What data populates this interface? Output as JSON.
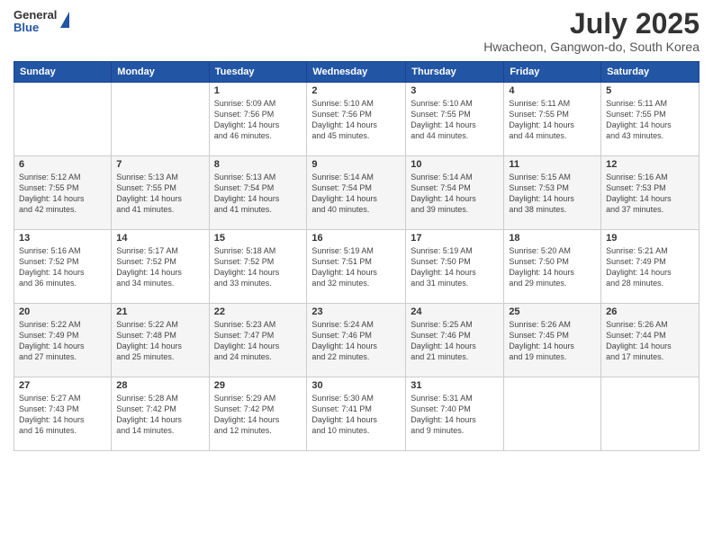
{
  "logo": {
    "line1": "General",
    "line2": "Blue"
  },
  "title": {
    "month_year": "July 2025",
    "location": "Hwacheon, Gangwon-do, South Korea"
  },
  "weekdays": [
    "Sunday",
    "Monday",
    "Tuesday",
    "Wednesday",
    "Thursday",
    "Friday",
    "Saturday"
  ],
  "weeks": [
    [
      {
        "day": "",
        "info": ""
      },
      {
        "day": "",
        "info": ""
      },
      {
        "day": "1",
        "info": "Sunrise: 5:09 AM\nSunset: 7:56 PM\nDaylight: 14 hours\nand 46 minutes."
      },
      {
        "day": "2",
        "info": "Sunrise: 5:10 AM\nSunset: 7:56 PM\nDaylight: 14 hours\nand 45 minutes."
      },
      {
        "day": "3",
        "info": "Sunrise: 5:10 AM\nSunset: 7:55 PM\nDaylight: 14 hours\nand 44 minutes."
      },
      {
        "day": "4",
        "info": "Sunrise: 5:11 AM\nSunset: 7:55 PM\nDaylight: 14 hours\nand 44 minutes."
      },
      {
        "day": "5",
        "info": "Sunrise: 5:11 AM\nSunset: 7:55 PM\nDaylight: 14 hours\nand 43 minutes."
      }
    ],
    [
      {
        "day": "6",
        "info": "Sunrise: 5:12 AM\nSunset: 7:55 PM\nDaylight: 14 hours\nand 42 minutes."
      },
      {
        "day": "7",
        "info": "Sunrise: 5:13 AM\nSunset: 7:55 PM\nDaylight: 14 hours\nand 41 minutes."
      },
      {
        "day": "8",
        "info": "Sunrise: 5:13 AM\nSunset: 7:54 PM\nDaylight: 14 hours\nand 41 minutes."
      },
      {
        "day": "9",
        "info": "Sunrise: 5:14 AM\nSunset: 7:54 PM\nDaylight: 14 hours\nand 40 minutes."
      },
      {
        "day": "10",
        "info": "Sunrise: 5:14 AM\nSunset: 7:54 PM\nDaylight: 14 hours\nand 39 minutes."
      },
      {
        "day": "11",
        "info": "Sunrise: 5:15 AM\nSunset: 7:53 PM\nDaylight: 14 hours\nand 38 minutes."
      },
      {
        "day": "12",
        "info": "Sunrise: 5:16 AM\nSunset: 7:53 PM\nDaylight: 14 hours\nand 37 minutes."
      }
    ],
    [
      {
        "day": "13",
        "info": "Sunrise: 5:16 AM\nSunset: 7:52 PM\nDaylight: 14 hours\nand 36 minutes."
      },
      {
        "day": "14",
        "info": "Sunrise: 5:17 AM\nSunset: 7:52 PM\nDaylight: 14 hours\nand 34 minutes."
      },
      {
        "day": "15",
        "info": "Sunrise: 5:18 AM\nSunset: 7:52 PM\nDaylight: 14 hours\nand 33 minutes."
      },
      {
        "day": "16",
        "info": "Sunrise: 5:19 AM\nSunset: 7:51 PM\nDaylight: 14 hours\nand 32 minutes."
      },
      {
        "day": "17",
        "info": "Sunrise: 5:19 AM\nSunset: 7:50 PM\nDaylight: 14 hours\nand 31 minutes."
      },
      {
        "day": "18",
        "info": "Sunrise: 5:20 AM\nSunset: 7:50 PM\nDaylight: 14 hours\nand 29 minutes."
      },
      {
        "day": "19",
        "info": "Sunrise: 5:21 AM\nSunset: 7:49 PM\nDaylight: 14 hours\nand 28 minutes."
      }
    ],
    [
      {
        "day": "20",
        "info": "Sunrise: 5:22 AM\nSunset: 7:49 PM\nDaylight: 14 hours\nand 27 minutes."
      },
      {
        "day": "21",
        "info": "Sunrise: 5:22 AM\nSunset: 7:48 PM\nDaylight: 14 hours\nand 25 minutes."
      },
      {
        "day": "22",
        "info": "Sunrise: 5:23 AM\nSunset: 7:47 PM\nDaylight: 14 hours\nand 24 minutes."
      },
      {
        "day": "23",
        "info": "Sunrise: 5:24 AM\nSunset: 7:46 PM\nDaylight: 14 hours\nand 22 minutes."
      },
      {
        "day": "24",
        "info": "Sunrise: 5:25 AM\nSunset: 7:46 PM\nDaylight: 14 hours\nand 21 minutes."
      },
      {
        "day": "25",
        "info": "Sunrise: 5:26 AM\nSunset: 7:45 PM\nDaylight: 14 hours\nand 19 minutes."
      },
      {
        "day": "26",
        "info": "Sunrise: 5:26 AM\nSunset: 7:44 PM\nDaylight: 14 hours\nand 17 minutes."
      }
    ],
    [
      {
        "day": "27",
        "info": "Sunrise: 5:27 AM\nSunset: 7:43 PM\nDaylight: 14 hours\nand 16 minutes."
      },
      {
        "day": "28",
        "info": "Sunrise: 5:28 AM\nSunset: 7:42 PM\nDaylight: 14 hours\nand 14 minutes."
      },
      {
        "day": "29",
        "info": "Sunrise: 5:29 AM\nSunset: 7:42 PM\nDaylight: 14 hours\nand 12 minutes."
      },
      {
        "day": "30",
        "info": "Sunrise: 5:30 AM\nSunset: 7:41 PM\nDaylight: 14 hours\nand 10 minutes."
      },
      {
        "day": "31",
        "info": "Sunrise: 5:31 AM\nSunset: 7:40 PM\nDaylight: 14 hours\nand 9 minutes."
      },
      {
        "day": "",
        "info": ""
      },
      {
        "day": "",
        "info": ""
      }
    ]
  ]
}
